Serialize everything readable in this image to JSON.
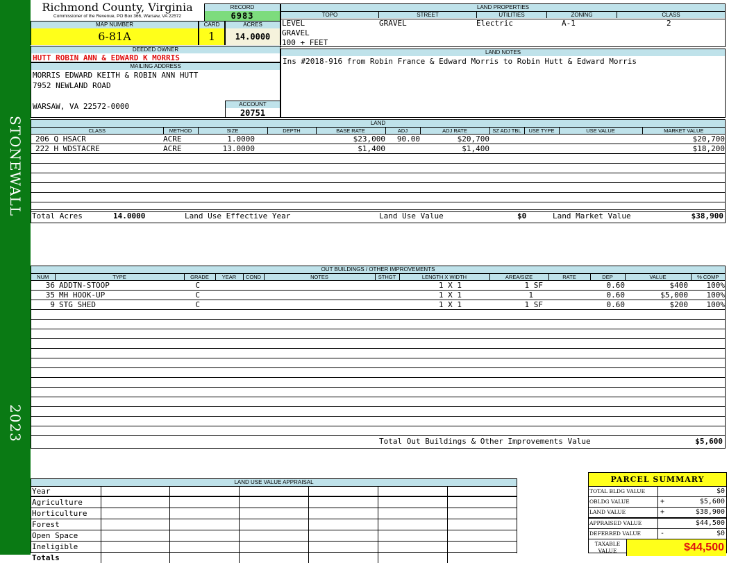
{
  "sidebar": {
    "district": "STONEWALL",
    "year": "2023"
  },
  "header": {
    "county": "Richmond County, Virginia",
    "commissioner": "Commissioner of the Revenue, PO Box 366, Warsaw, VA 22572"
  },
  "record": {
    "label": "RECORD",
    "value": "6983"
  },
  "map": {
    "label": "MAP NUMBER",
    "value": "6-81A"
  },
  "card": {
    "label": "CARD",
    "value": "1"
  },
  "acres": {
    "label": "ACRES",
    "value": "14.0000"
  },
  "owner": {
    "label": "DEEDED OWNER",
    "value": "HUTT ROBIN ANN & EDWARD K MORRIS"
  },
  "mailing": {
    "label": "MAILING ADDRESS",
    "line1": "MORRIS EDWARD KEITH & ROBIN ANN HUTT",
    "line2": "7952 NEWLAND ROAD",
    "line3": "WARSAW, VA 22572-0000"
  },
  "account": {
    "label": "ACCOUNT",
    "value": "20751"
  },
  "land_properties": {
    "title": "LAND PROPERTIES",
    "topo_label": "TOPO",
    "street_label": "STREET",
    "utilities_label": "UTILITIES",
    "zoning_label": "ZONING",
    "class_label": "CLASS",
    "topo1": "LEVEL",
    "topo2": "GRAVEL",
    "topo3": "100 + FEET",
    "street": "GRAVEL",
    "utilities": "Electric",
    "zoning": "A-1",
    "class": "2"
  },
  "land_notes": {
    "title": "LAND NOTES",
    "text": "Ins #2018-916 from Robin France & Edward Morris to Robin Hutt & Edward Morris"
  },
  "land": {
    "title": "LAND",
    "headers": [
      "CLASS",
      "METHOD",
      "SIZE",
      "DEPTH",
      "BASE RATE",
      "ADJ",
      "ADJ RATE",
      "SZ ADJ TBL",
      "USE TYPE",
      "USE VALUE",
      "MARKET VALUE"
    ],
    "rows": [
      {
        "class": "206 Q HSACR",
        "method": "ACRE",
        "size": "1.0000",
        "depth": "",
        "base": "$23,000",
        "adj": "90.00",
        "adjrate": "$20,700",
        "sz": "",
        "use": "",
        "usevalue": "",
        "market": "$20,700"
      },
      {
        "class": "222 H WDSTACRE",
        "method": "ACRE",
        "size": "13.0000",
        "depth": "",
        "base": "$1,400",
        "adj": "",
        "adjrate": "$1,400",
        "sz": "",
        "use": "",
        "usevalue": "",
        "market": "$18,200"
      }
    ],
    "total_acres_label": "Total Acres",
    "total_acres": "14.0000",
    "effective_year_label": "Land Use Effective Year",
    "use_value_label": "Land Use Value",
    "use_value": "$0",
    "market_value_label": "Land Market Value",
    "market_value": "$38,900"
  },
  "outbuildings": {
    "title": "OUT BUILDINGS / OTHER IMPROVEMENTS",
    "headers": [
      "NUM",
      "TYPE",
      "GRADE",
      "YEAR",
      "COND",
      "NOTES",
      "STHGT",
      "LENGTH X WIDTH",
      "AREA/SIZE",
      "RATE",
      "DEP",
      "VALUE",
      "% COMP"
    ],
    "rows": [
      {
        "num": "36",
        "type": "ADDTN-STOOP",
        "grade": "C",
        "lw": "1 X 1",
        "area": "1 SF",
        "dep": "0.60",
        "value": "$400",
        "comp": "100%"
      },
      {
        "num": "35",
        "type": "MH HOOK-UP",
        "grade": "C",
        "lw": "1 X 1",
        "area": "1",
        "dep": "0.60",
        "value": "$5,000",
        "comp": "100%"
      },
      {
        "num": "9",
        "type": "STG SHED",
        "grade": "C",
        "lw": "1 X 1",
        "area": "1 SF",
        "dep": "0.60",
        "value": "$200",
        "comp": "100%"
      }
    ],
    "total_label": "Total Out Buildings & Other Improvements Value",
    "total": "$5,600"
  },
  "land_use": {
    "title": "LAND USE VALUE APPRAISAL",
    "rows": [
      "Year",
      "Agriculture",
      "Horticulture",
      "Forest",
      "Open Space",
      "Ineligible",
      "Totals"
    ]
  },
  "summary": {
    "title": "PARCEL SUMMARY",
    "rows": [
      {
        "label": "TOTAL BLDG VALUE",
        "op": "",
        "value": "$0"
      },
      {
        "label": "OBLDG VALUE",
        "op": "+",
        "value": "$5,600"
      },
      {
        "label": "LAND VALUE",
        "op": "+",
        "value": "$38,900"
      },
      {
        "label": "APPRAISED VALUE",
        "op": "",
        "value": "$44,500"
      },
      {
        "label": "DEFERRED VALUE",
        "op": "-",
        "value": "$0"
      }
    ],
    "taxable_label_1": "TAXABLE",
    "taxable_label_2": "VALUE",
    "taxable": "$44,500"
  }
}
